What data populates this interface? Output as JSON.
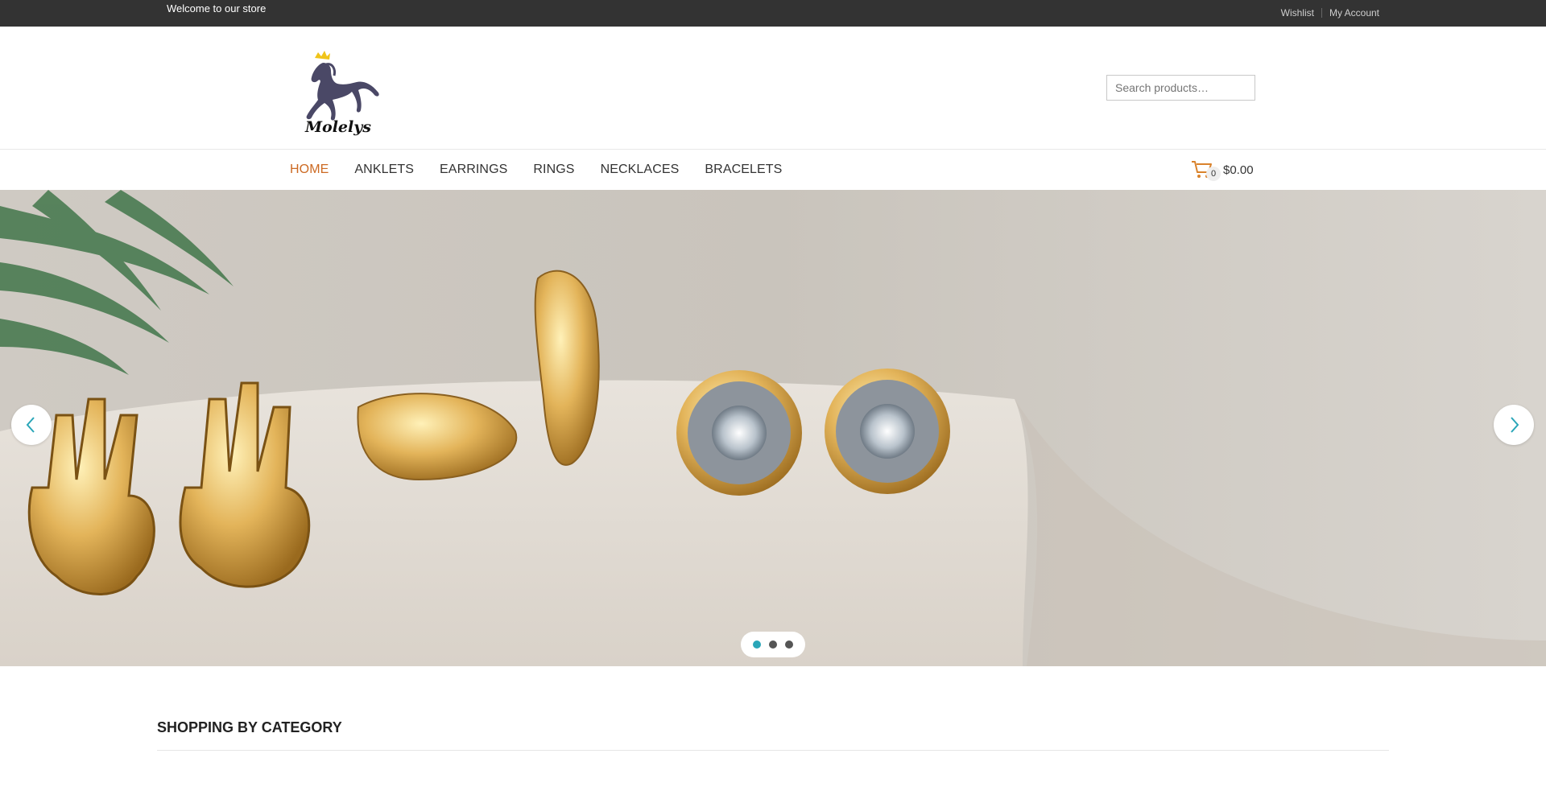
{
  "topbar": {
    "welcome": "Welcome to our store",
    "wishlist": "Wishlist",
    "account": "My Account"
  },
  "header": {
    "logo_text": "Molelys",
    "search_placeholder": "Search products…"
  },
  "nav": {
    "items": [
      {
        "label": "HOME",
        "active": true
      },
      {
        "label": "ANKLETS"
      },
      {
        "label": "EARRINGS"
      },
      {
        "label": "RINGS"
      },
      {
        "label": "NECKLACES"
      },
      {
        "label": "BRACELETS"
      }
    ]
  },
  "cart": {
    "count": "0",
    "total": "$0.00"
  },
  "slider": {
    "current_slide": 1,
    "slide_count": 3,
    "prev_icon": "chevron-left-icon",
    "next_icon": "chevron-right-icon"
  },
  "section": {
    "title": "SHOPPING BY CATEGORY"
  },
  "colors": {
    "topbar_bg": "#333333",
    "nav_active": "#cc6a23",
    "accent": "#2aa6b8"
  }
}
